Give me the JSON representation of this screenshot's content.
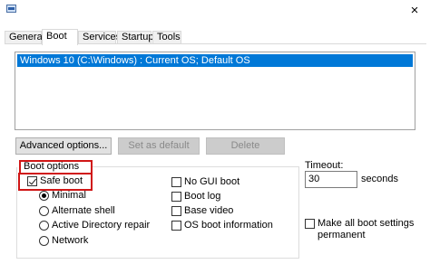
{
  "window": {
    "close_glyph": "×",
    "app_icon": "msconfig-icon"
  },
  "tabs": [
    "General",
    "Boot",
    "Services",
    "Startup",
    "Tools"
  ],
  "active_tab": "Boot",
  "os_list": [
    "Windows 10 (C:\\Windows) : Current OS; Default OS"
  ],
  "buttons": {
    "advanced": "Advanced options...",
    "set_default": "Set as default",
    "delete": "Delete"
  },
  "boot_options": {
    "title": "Boot options",
    "safe_boot": {
      "label": "Safe boot",
      "checked": true
    },
    "radios": [
      {
        "label": "Minimal",
        "checked": true
      },
      {
        "label": "Alternate shell",
        "checked": false
      },
      {
        "label": "Active Directory repair",
        "checked": false
      },
      {
        "label": "Network",
        "checked": false
      }
    ],
    "checkboxes": [
      {
        "label": "No GUI boot",
        "checked": false
      },
      {
        "label": "Boot log",
        "checked": false
      },
      {
        "label": "Base video",
        "checked": false
      },
      {
        "label": "OS boot information",
        "checked": false
      }
    ]
  },
  "timeout": {
    "label": "Timeout:",
    "value": "30",
    "unit": "seconds"
  },
  "permanent": {
    "label_line1": "Make all boot settings",
    "label_line2": "permanent",
    "checked": false
  },
  "colors": {
    "selection": "#0078d7",
    "highlight_box": "#d01616"
  }
}
